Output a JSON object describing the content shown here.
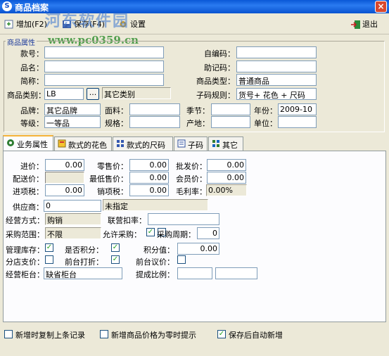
{
  "window": {
    "title": "商品档案",
    "close_glyph": "×"
  },
  "watermark": {
    "line1": "河东软件园",
    "line2": "www.pc0359.cn"
  },
  "toolbar": {
    "add": "增加(F2)",
    "save": "保存(F4)",
    "settings": "设置",
    "exit": "退出"
  },
  "section_label": "商品属性",
  "fields": {
    "code_label": "款号：",
    "code_value": "",
    "selfcode_label": "自编码：",
    "selfcode_value": "",
    "name_label": "品名：",
    "name_value": "",
    "mnemonic_label": "助记码：",
    "mnemonic_value": "",
    "short_label": "简称：",
    "short_value": "",
    "type_label": "商品类型：",
    "type_value": "普通商品",
    "category_label": "商品类别：",
    "category_value": "LB",
    "category_btn": "...",
    "category_name": "其它类别",
    "subcode_label": "子码规则：",
    "subcode_value": "货号+ 花色 + 尺码",
    "brand_label": "品牌：",
    "brand_value": "其它品牌",
    "fabric_label": "面料：",
    "fabric_value": "",
    "season_label": "季节：",
    "season_value": "",
    "year_label": "年份：",
    "year_value": "2009-10",
    "grade_label": "等级：",
    "grade_value": "一等品",
    "spec_label": "规格：",
    "spec_value": "",
    "origin_label": "产地：",
    "origin_value": "",
    "unit_label": "单位：",
    "unit_value": ""
  },
  "tabs": [
    {
      "label": "业务属性",
      "icon": "business-icon"
    },
    {
      "label": "款式的花色",
      "icon": "color-icon"
    },
    {
      "label": "款式的尺码",
      "icon": "size-icon"
    },
    {
      "label": "子码",
      "icon": "subcode-icon"
    },
    {
      "label": "其它",
      "icon": "other-icon"
    }
  ],
  "business": {
    "purchase_price_label": "进价：",
    "purchase_price": "0.00",
    "retail_price_label": "零售价：",
    "retail_price": "0.00",
    "wholesale_price_label": "批发价：",
    "wholesale_price": "0.00",
    "delivery_price_label": "配送价：",
    "delivery_price": "",
    "min_price_label": "最低售价：",
    "min_price": "0.00",
    "member_price_label": "会员价：",
    "member_price": "0.00",
    "input_tax_label": "进项税：",
    "input_tax": "0.00",
    "output_tax_label": "销项税：",
    "output_tax": "0.00",
    "margin_label": "毛利率：",
    "margin": "0.00%",
    "supplier_label": "供应商：",
    "supplier_code": "0",
    "supplier_name": "未指定",
    "mode_label": "经营方式：",
    "mode_value": "购销",
    "joint_rate_label": "联营扣率：",
    "joint_rate": "",
    "scope_label": "采购范围：",
    "scope_value": "不限",
    "allow_purchase_label": "允许采购：",
    "cycle_label": "采购周期：",
    "cycle_value": "0",
    "manage_stock_label": "管理库存：",
    "points_label": "是否积分：",
    "points_value_label": "积分值：",
    "points_value": "0.00",
    "branch_price_label": "分店支价：",
    "discount_label": "前台打折：",
    "bargain_label": "前台议价：",
    "counter_label": "经营柜台：",
    "counter_value": "缺省柜台",
    "commission_label": "提成比例：",
    "commission_a": "",
    "commission_b": ""
  },
  "checks": {
    "manage_stock": true,
    "points": true,
    "allow_purchase": true,
    "branch_price": false,
    "discount": true,
    "bargain": false,
    "purchase_cycle": false
  },
  "footer": {
    "copy_label": "新增时复制上条记录",
    "copy_checked": false,
    "zero_label": "新增商品价格为零时提示",
    "zero_checked": false,
    "autoadd_label": "保存后自动新增",
    "autoadd_checked": true
  }
}
